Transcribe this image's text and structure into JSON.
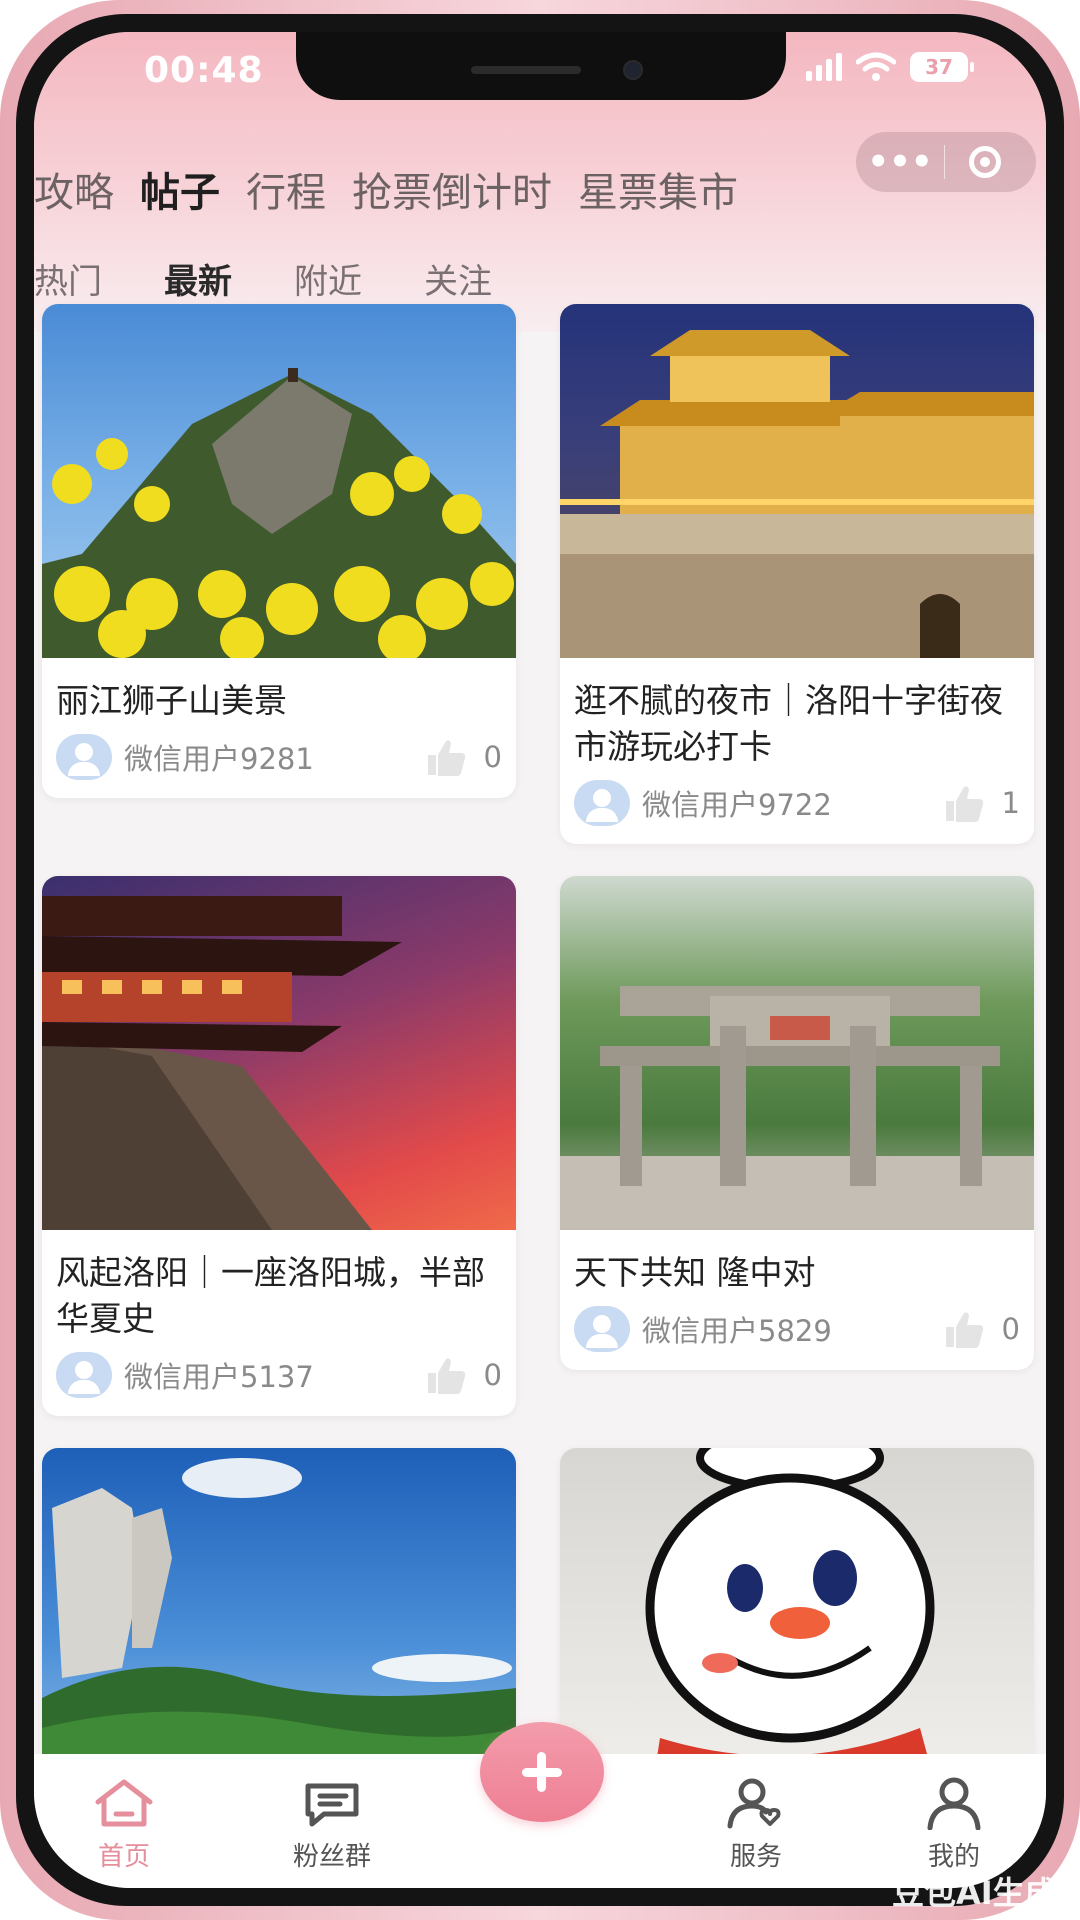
{
  "status_bar": {
    "time": "00:48",
    "battery": "37"
  },
  "top_tabs": [
    {
      "label": "攻略",
      "active": false
    },
    {
      "label": "帖子",
      "active": true
    },
    {
      "label": "行程",
      "active": false
    },
    {
      "label": "抢票倒计时",
      "active": false
    },
    {
      "label": "星票集市",
      "active": false
    }
  ],
  "capsule": {
    "more": "•••"
  },
  "sub_tabs": [
    {
      "label": "热门",
      "active": false
    },
    {
      "label": "最新",
      "active": true
    },
    {
      "label": "附近",
      "active": false
    },
    {
      "label": "关注",
      "active": false
    }
  ],
  "posts": [
    {
      "title": "丽江狮子山美景",
      "user": "微信用户9281",
      "likes": "0"
    },
    {
      "title": "逛不腻的夜市｜洛阳十字街夜市游玩必打卡",
      "user": "微信用户9722",
      "likes": "1"
    },
    {
      "title": "风起洛阳｜一座洛阳城，半部华夏史",
      "user": "微信用户5137",
      "likes": "0"
    },
    {
      "title": "天下共知 隆中对",
      "user": "微信用户5829",
      "likes": "0"
    },
    {
      "title": "",
      "user": "",
      "likes": ""
    },
    {
      "title": "",
      "user": "",
      "likes": ""
    }
  ],
  "bottom_nav": [
    {
      "label": "首页",
      "icon": "home-icon",
      "active": true
    },
    {
      "label": "粉丝群",
      "icon": "chat-icon",
      "active": false
    },
    {
      "label": "服务",
      "icon": "service-icon",
      "active": false
    },
    {
      "label": "我的",
      "icon": "profile-icon",
      "active": false
    }
  ],
  "watermark": "豆包AI生成",
  "colors": {
    "accent": "#e58e9c",
    "plus": "#ee7f93",
    "header_top": "#f4b7c0"
  }
}
